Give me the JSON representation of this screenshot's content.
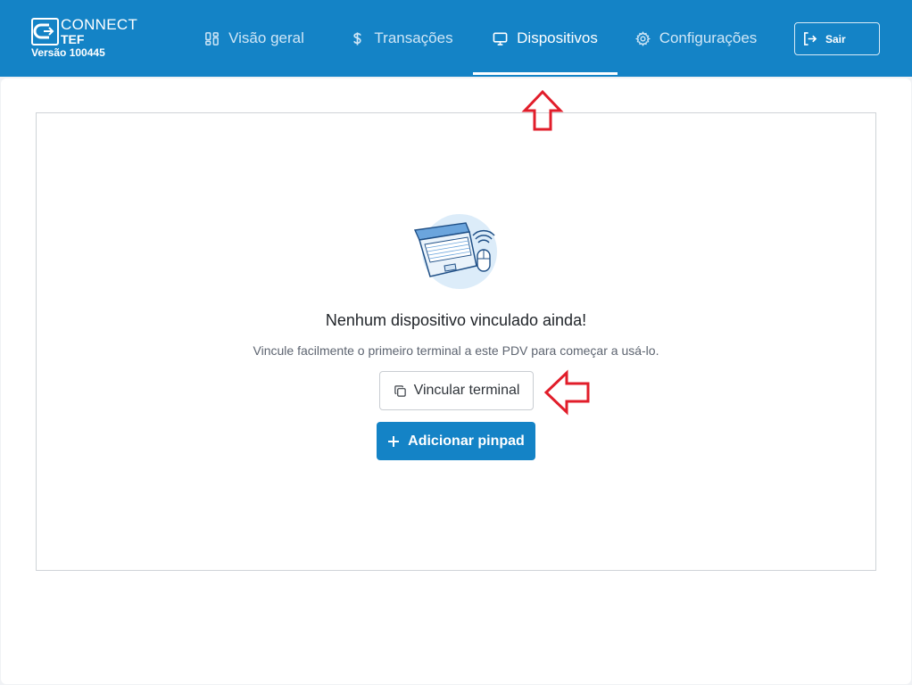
{
  "app": {
    "logo_connect": "CONNECT",
    "logo_tef": "TEF",
    "version": "Versão 100445"
  },
  "nav": {
    "tabs": [
      {
        "label": "Visão geral",
        "icon": "dashboard-icon",
        "active": false
      },
      {
        "label": "Transações",
        "icon": "dollar-icon",
        "active": false
      },
      {
        "label": "Dispositivos",
        "icon": "monitor-icon",
        "active": true
      },
      {
        "label": "Configurações",
        "icon": "gear-icon",
        "active": false
      }
    ],
    "logout_label": "Sair"
  },
  "empty_state": {
    "title": "Nenhum dispositivo vinculado ainda!",
    "description": "Vincule facilmente o primeiro terminal a este PDV para começar a usá-lo.",
    "link_button_label": "Vincular terminal",
    "add_button_label": "Adicionar pinpad"
  },
  "colors": {
    "brand": "#1483c6",
    "annotation_arrow": "#e11d2a"
  }
}
